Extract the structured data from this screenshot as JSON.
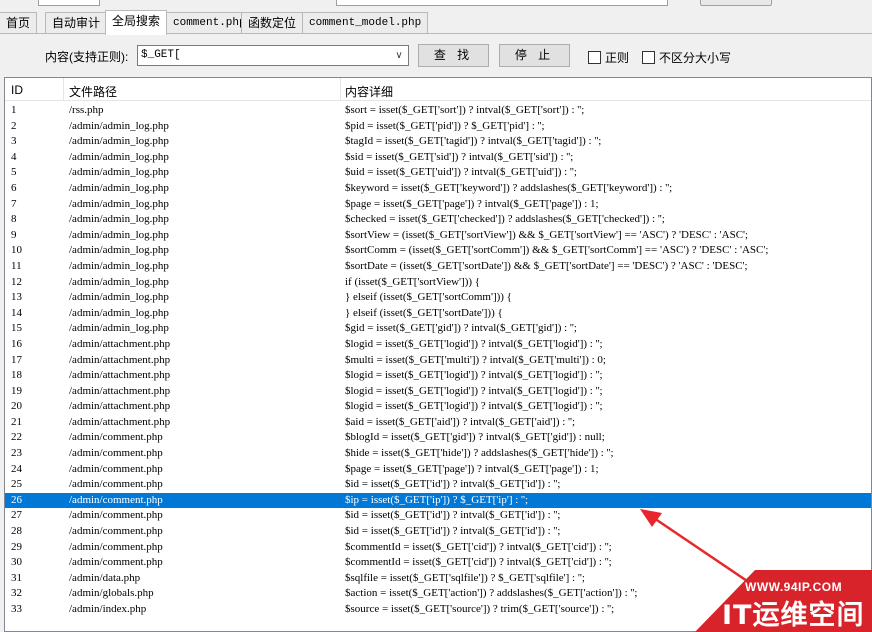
{
  "tabs": [
    {
      "label": "首页"
    },
    {
      "label": "自动审计"
    },
    {
      "label": "全局搜索"
    },
    {
      "label": "comment.php"
    },
    {
      "label": "函数定位"
    },
    {
      "label": "comment_model.php"
    }
  ],
  "search": {
    "label": "内容(支持正则):",
    "value": "$_GET[",
    "find_label": "查 找",
    "stop_label": "停 止",
    "regex_label": "正则",
    "case_label": "不区分大小写"
  },
  "columns": {
    "id": "ID",
    "path": "文件路径",
    "detail": "内容详细"
  },
  "selected_row": 26,
  "rows": [
    {
      "id": "1",
      "path": "/rss.php",
      "detail": "$sort = isset($_GET['sort']) ? intval($_GET['sort']) : '';"
    },
    {
      "id": "2",
      "path": "/admin/admin_log.php",
      "detail": "$pid = isset($_GET['pid']) ? $_GET['pid'] : '';"
    },
    {
      "id": "3",
      "path": "/admin/admin_log.php",
      "detail": "$tagId = isset($_GET['tagid']) ? intval($_GET['tagid']) : '';"
    },
    {
      "id": "4",
      "path": "/admin/admin_log.php",
      "detail": "$sid = isset($_GET['sid']) ? intval($_GET['sid']) : '';"
    },
    {
      "id": "5",
      "path": "/admin/admin_log.php",
      "detail": "$uid = isset($_GET['uid']) ? intval($_GET['uid']) : '';"
    },
    {
      "id": "6",
      "path": "/admin/admin_log.php",
      "detail": "$keyword = isset($_GET['keyword']) ? addslashes($_GET['keyword']) : '';"
    },
    {
      "id": "7",
      "path": "/admin/admin_log.php",
      "detail": "$page = isset($_GET['page']) ? intval($_GET['page']) : 1;"
    },
    {
      "id": "8",
      "path": "/admin/admin_log.php",
      "detail": "$checked = isset($_GET['checked']) ? addslashes($_GET['checked']) : '';"
    },
    {
      "id": "9",
      "path": "/admin/admin_log.php",
      "detail": "$sortView = (isset($_GET['sortView']) && $_GET['sortView'] == 'ASC') ?  'DESC' : 'ASC';"
    },
    {
      "id": "10",
      "path": "/admin/admin_log.php",
      "detail": "$sortComm = (isset($_GET['sortComm']) && $_GET['sortComm'] == 'ASC') ?  'DESC' : 'ASC';"
    },
    {
      "id": "11",
      "path": "/admin/admin_log.php",
      "detail": "$sortDate = (isset($_GET['sortDate']) && $_GET['sortDate'] == 'DESC') ?  'ASC' : 'DESC';"
    },
    {
      "id": "12",
      "path": "/admin/admin_log.php",
      "detail": "if (isset($_GET['sortView'])) {"
    },
    {
      "id": "13",
      "path": "/admin/admin_log.php",
      "detail": "} elseif (isset($_GET['sortComm'])) {"
    },
    {
      "id": "14",
      "path": "/admin/admin_log.php",
      "detail": "} elseif (isset($_GET['sortDate'])) {"
    },
    {
      "id": "15",
      "path": "/admin/admin_log.php",
      "detail": "$gid = isset($_GET['gid']) ? intval($_GET['gid']) : '';"
    },
    {
      "id": "16",
      "path": "/admin/attachment.php",
      "detail": "$logid = isset($_GET['logid']) ? intval($_GET['logid']) : '';"
    },
    {
      "id": "17",
      "path": "/admin/attachment.php",
      "detail": "$multi = isset($_GET['multi']) ? intval($_GET['multi']) : 0;"
    },
    {
      "id": "18",
      "path": "/admin/attachment.php",
      "detail": "$logid = isset($_GET['logid']) ? intval($_GET['logid']) : '';"
    },
    {
      "id": "19",
      "path": "/admin/attachment.php",
      "detail": "$logid = isset($_GET['logid']) ? intval($_GET['logid']) : '';"
    },
    {
      "id": "20",
      "path": "/admin/attachment.php",
      "detail": "$logid = isset($_GET['logid']) ? intval($_GET['logid']) : '';"
    },
    {
      "id": "21",
      "path": "/admin/attachment.php",
      "detail": "$aid = isset($_GET['aid']) ? intval($_GET['aid']) : '';"
    },
    {
      "id": "22",
      "path": "/admin/comment.php",
      "detail": "$blogId = isset($_GET['gid']) ? intval($_GET['gid']) : null;"
    },
    {
      "id": "23",
      "path": "/admin/comment.php",
      "detail": "$hide = isset($_GET['hide']) ? addslashes($_GET['hide']) : '';"
    },
    {
      "id": "24",
      "path": "/admin/comment.php",
      "detail": "$page = isset($_GET['page']) ? intval($_GET['page']) : 1;"
    },
    {
      "id": "25",
      "path": "/admin/comment.php",
      "detail": "$id = isset($_GET['id']) ? intval($_GET['id']) : '';"
    },
    {
      "id": "26",
      "path": "/admin/comment.php",
      "detail": "$ip = isset($_GET['ip']) ? $_GET['ip'] : '';"
    },
    {
      "id": "27",
      "path": "/admin/comment.php",
      "detail": "$id = isset($_GET['id']) ? intval($_GET['id']) : '';"
    },
    {
      "id": "28",
      "path": "/admin/comment.php",
      "detail": "$id = isset($_GET['id']) ? intval($_GET['id']) : '';"
    },
    {
      "id": "29",
      "path": "/admin/comment.php",
      "detail": "$commentId = isset($_GET['cid']) ? intval($_GET['cid']) : '';"
    },
    {
      "id": "30",
      "path": "/admin/comment.php",
      "detail": "$commentId = isset($_GET['cid']) ? intval($_GET['cid']) : '';"
    },
    {
      "id": "31",
      "path": "/admin/data.php",
      "detail": "$sqlfile = isset($_GET['sqlfile']) ? $_GET['sqlfile'] : '';"
    },
    {
      "id": "32",
      "path": "/admin/globals.php",
      "detail": "$action = isset($_GET['action']) ? addslashes($_GET['action']) : '';"
    },
    {
      "id": "33",
      "path": "/admin/index.php",
      "detail": "$source = isset($_GET['source']) ? trim($_GET['source']) : '';"
    }
  ],
  "watermark": {
    "url": "WWW.94IP.COM",
    "brand": "IT运维空间"
  },
  "colors": {
    "selection": "#0078d7",
    "annotation": "#e8262c"
  }
}
